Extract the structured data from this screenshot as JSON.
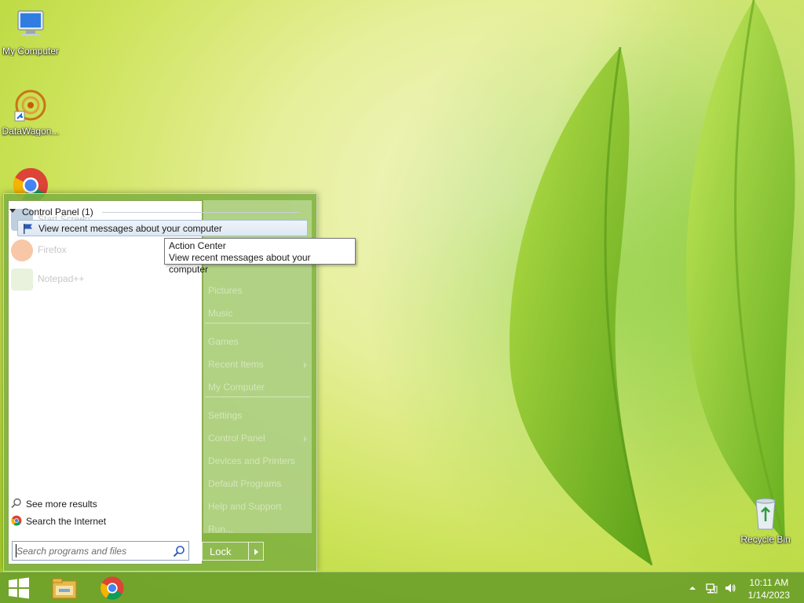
{
  "desktop": {
    "icons": [
      {
        "label": "My Computer"
      },
      {
        "label": "DataWagon..."
      },
      {
        "label": "Recycle Bin"
      }
    ]
  },
  "start_menu": {
    "category_header": "Control Panel (1)",
    "result_item": "View recent messages about your computer",
    "faded_items": [
      "Start Screen",
      "Firefox",
      "Notepad++"
    ],
    "right_items": [
      "Pictures",
      "Music",
      "Games",
      "Recent Items",
      "My Computer",
      "Settings",
      "Control Panel",
      "Devices and Printers",
      "Default Programs",
      "Help and Support",
      "Run..."
    ],
    "see_more": "See more results",
    "search_internet": "Search the Internet",
    "search_placeholder": "Search programs and files",
    "lock_label": "Lock"
  },
  "tooltip": {
    "title": "Action Center",
    "description": "View recent messages about your computer"
  },
  "taskbar": {
    "time": "10:11 AM",
    "date": "1/14/2023",
    "icons": [
      "windows-start-icon",
      "file-explorer-icon",
      "chrome-icon"
    ],
    "tray_icons": [
      "show-hidden-icons-icon",
      "network-icon",
      "volume-icon"
    ]
  }
}
